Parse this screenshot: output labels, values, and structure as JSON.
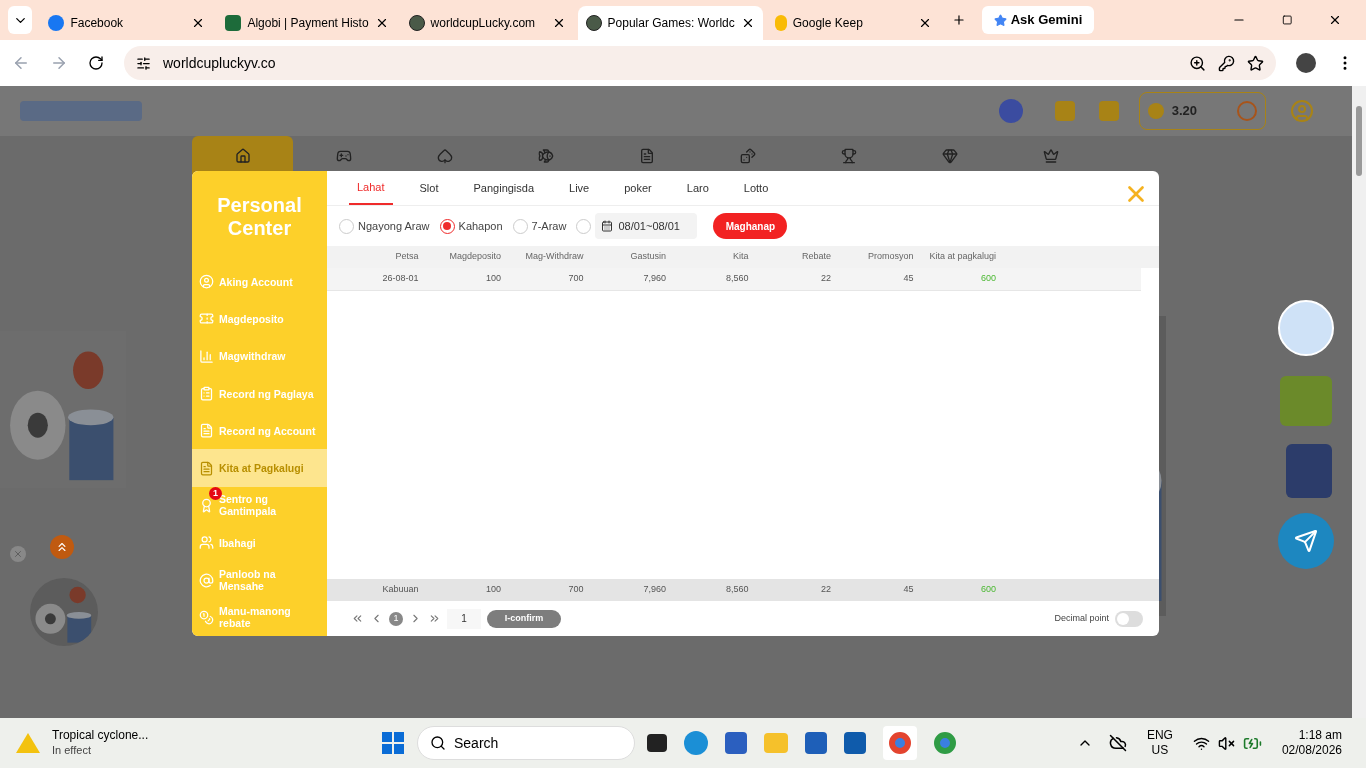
{
  "browser": {
    "tabs": [
      {
        "title": "Facebook",
        "selected": false
      },
      {
        "title": "Algobi | Payment Histo",
        "selected": false
      },
      {
        "title": "worldcupLucky.com",
        "selected": false
      },
      {
        "title": "Popular Games: Worldc",
        "selected": true
      },
      {
        "title": "Google Keep",
        "selected": false
      }
    ],
    "ask_gemini": "Ask Gemini",
    "address": "worldcupluckyv.co"
  },
  "site": {
    "balance": "3.20",
    "nav": [
      {
        "selected": true
      },
      {
        "selected": false
      },
      {
        "selected": false
      },
      {
        "selected": false
      },
      {
        "selected": false
      },
      {
        "selected": false
      },
      {
        "selected": false
      },
      {
        "selected": false
      },
      {
        "selected": false
      }
    ]
  },
  "modal": {
    "title": "Personal Center",
    "menu": [
      {
        "label": "Aking Account",
        "selected": false
      },
      {
        "label": "Magdeposito",
        "selected": false
      },
      {
        "label": "Magwithdraw",
        "selected": false
      },
      {
        "label": "Record ng Paglaya",
        "selected": false
      },
      {
        "label": "Record ng Account",
        "selected": false
      },
      {
        "label": "Kita at Pagkalugi",
        "selected": true
      },
      {
        "label": "Sentro ng Gantimpala",
        "selected": false,
        "badge": "1"
      },
      {
        "label": "Ibahagi",
        "selected": false
      },
      {
        "label": "Panloob na Mensahe",
        "selected": false
      },
      {
        "label": "Manu-manong rebate",
        "selected": false
      }
    ],
    "tabs": [
      {
        "label": "Lahat",
        "selected": true
      },
      {
        "label": "Slot",
        "selected": false
      },
      {
        "label": "Pangingisda",
        "selected": false
      },
      {
        "label": "Live",
        "selected": false
      },
      {
        "label": "poker",
        "selected": false
      },
      {
        "label": "Laro",
        "selected": false
      },
      {
        "label": "Lotto",
        "selected": false
      }
    ],
    "filters": [
      {
        "label": "Ngayong Araw",
        "selected": false
      },
      {
        "label": "Kahapon",
        "selected": true
      },
      {
        "label": "7-Araw",
        "selected": false
      },
      {
        "selected": false
      }
    ],
    "date_range": "08/01~08/01",
    "search_button": "Maghanap",
    "table": {
      "columns": [
        "Petsa",
        "Magdeposito",
        "Mag-Withdraw",
        "Gastusin",
        "Kita",
        "Rebate",
        "Promosyon",
        "Kita at pagkalugi"
      ],
      "rows": [
        [
          "26-08-01",
          "100",
          "700",
          "7,960",
          "8,560",
          "22",
          "45",
          "600"
        ]
      ],
      "total": [
        "Kabuuan",
        "100",
        "700",
        "7,960",
        "8,560",
        "22",
        "45",
        "600"
      ]
    },
    "pagination": {
      "page": "1",
      "page_input": "1",
      "confirm": "I-confirm"
    },
    "decimal_point": {
      "label": "Decimal point",
      "on": false
    }
  },
  "taskbar": {
    "weather_title": "Tropical cyclone...",
    "weather_subtitle": "In effect",
    "search": "Search",
    "lang": "ENG",
    "region": "US",
    "time": "1:18 am",
    "date": "02/08/2026"
  }
}
